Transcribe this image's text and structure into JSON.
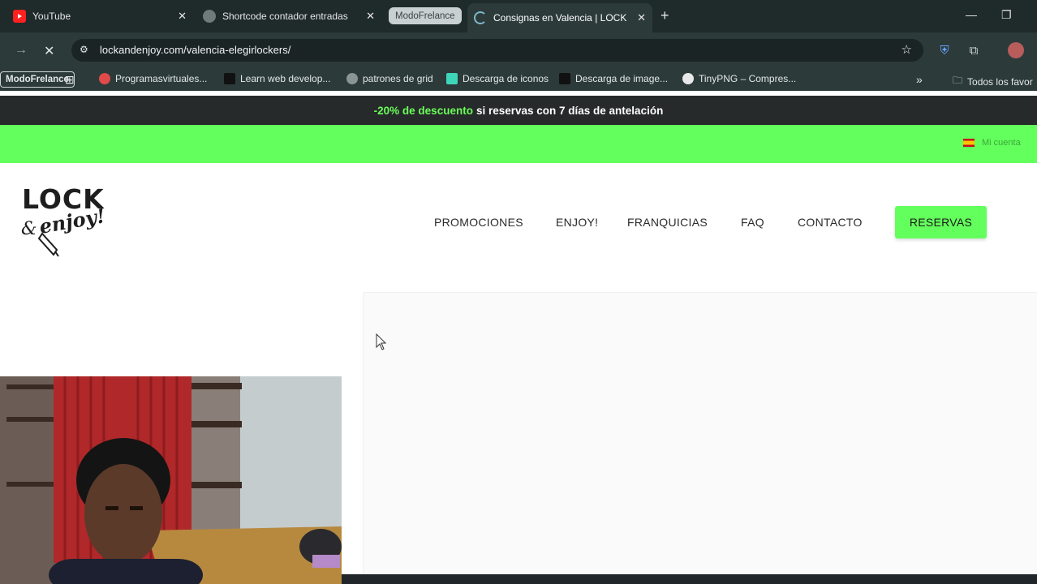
{
  "tabs": {
    "youtube": "YouTube",
    "shortcode": "Shortcode contador entradas",
    "group": "ModoFrelance",
    "active": "Consignas en Valencia | LOCK &"
  },
  "toolbar": {
    "url": "lockandenjoy.com/valencia-elegirlockers/"
  },
  "bookmarks": {
    "modo": "ModoFrelance",
    "items": [
      "Programasvirtuales...",
      "Learn web develop...",
      "patrones de grid",
      "Descarga de iconos",
      "Descarga de image...",
      "TinyPNG – Compres..."
    ],
    "all": "Todos los favor"
  },
  "promo": {
    "highlight": "-20% de descuento",
    "rest": "si reservas con 7 días de antelación"
  },
  "topbar": {
    "account": "Mi cuenta"
  },
  "logo": {
    "line1": "LOCK",
    "line2": "enjoy!",
    "amp": "&"
  },
  "nav": {
    "items": [
      "PROMOCIONES",
      "ENJOY!",
      "FRANQUICIAS",
      "FAQ",
      "CONTACTO"
    ],
    "cta": "RESERVAS"
  },
  "colors": {
    "brand_green": "#63ff5c",
    "promo_bg": "#262a2a"
  }
}
